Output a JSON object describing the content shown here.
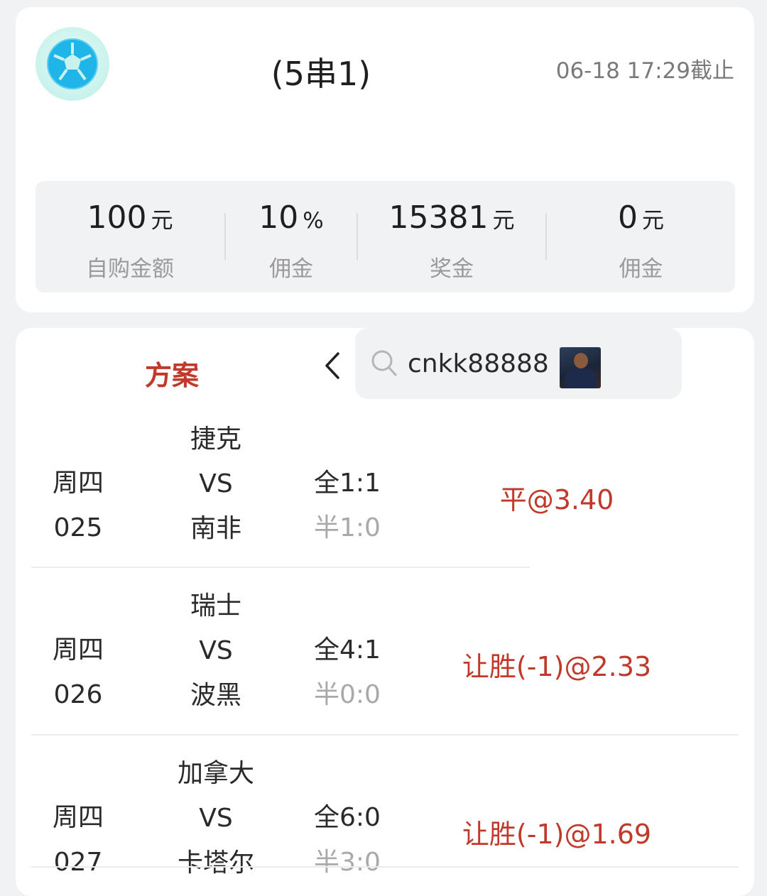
{
  "header": {
    "logo_icon": "soccer-ball-icon",
    "title": "(5串1)",
    "deadline": "06-18 17:29截止"
  },
  "stats": [
    {
      "value": "100",
      "unit": "元",
      "label": "自购金额"
    },
    {
      "value": "10",
      "unit": "%",
      "label": "佣金"
    },
    {
      "value": "15381",
      "unit": "元",
      "label": "奖金"
    },
    {
      "value": "0",
      "unit": "元",
      "label": "佣金"
    }
  ],
  "tabs": {
    "plan": "方案"
  },
  "search": {
    "value": "cnkk88888"
  },
  "matches": [
    {
      "day": "周四",
      "num": "025",
      "home": "捷克",
      "vs": "VS",
      "away": "南非",
      "full": "全1:1",
      "half": "半1:0",
      "result": "平@3.40"
    },
    {
      "day": "周四",
      "num": "026",
      "home": "瑞士",
      "vs": "VS",
      "away": "波黑",
      "full": "全4:1",
      "half": "半0:0",
      "result": "让胜(-1)@2.33"
    },
    {
      "day": "周四",
      "num": "027",
      "home": "加拿大",
      "vs": "VS",
      "away": "卡塔尔",
      "full": "全6:0",
      "half": "半3:0",
      "result": "让胜(-1)@1.69"
    }
  ],
  "colors": {
    "accent": "#c0392b",
    "logo": "#1fb5e8"
  }
}
